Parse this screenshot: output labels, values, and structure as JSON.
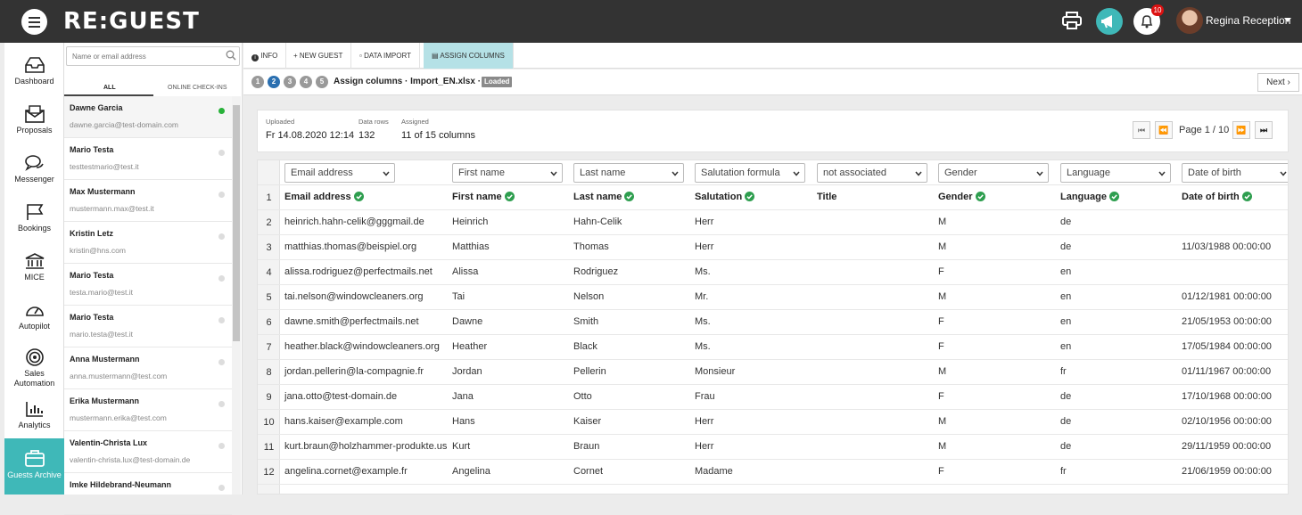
{
  "app": {
    "logo": "RE:GUEST",
    "user_name": "Regina Reception",
    "notification_count": "10"
  },
  "nav": [
    {
      "label": "Dashboard",
      "icon": "dashboard-icon"
    },
    {
      "label": "Proposals",
      "icon": "proposals-icon"
    },
    {
      "label": "Messenger",
      "icon": "messenger-icon"
    },
    {
      "label": "Bookings",
      "icon": "bookings-icon"
    },
    {
      "label": "MICE",
      "icon": "mice-icon"
    },
    {
      "label": "Autopilot",
      "icon": "autopilot-icon"
    },
    {
      "label": "Sales Automation",
      "icon": "sales-automation-icon"
    },
    {
      "label": "Analytics",
      "icon": "analytics-icon"
    },
    {
      "label": "Guests Archive",
      "icon": "guests-archive-icon",
      "active": true
    }
  ],
  "guest_list": {
    "search_placeholder": "Name or email address",
    "tab_all": "ALL",
    "tab_online": "ONLINE CHECK-INS",
    "items": [
      {
        "name": "Dawne Garcia",
        "email": "dawne.garcia@test-domain.com",
        "online": true
      },
      {
        "name": "Mario Testa",
        "email": "testtestmario@test.it"
      },
      {
        "name": "Max Mustermann",
        "email": "mustermann.max@test.it"
      },
      {
        "name": "Kristin Letz",
        "email": "kristin@hns.com"
      },
      {
        "name": "Mario Testa",
        "email": "testa.mario@test.it"
      },
      {
        "name": "Mario Testa",
        "email": "mario.testa@test.it"
      },
      {
        "name": "Anna Mustermann",
        "email": "anna.mustermann@test.com"
      },
      {
        "name": "Erika Mustermann",
        "email": "mustermann.erika@test.com"
      },
      {
        "name": "Valentin-Christa Lux",
        "email": "valentin-christa.lux@test-domain.de"
      },
      {
        "name": "Imke Hildebrand-Neumann",
        "email": ""
      }
    ]
  },
  "tabs": {
    "info": "INFO",
    "new_guest": "+ NEW GUEST",
    "data_import": "DATA IMPORT",
    "assign_columns": "ASSIGN COLUMNS"
  },
  "wizard": {
    "steps": [
      "1",
      "2",
      "3",
      "4",
      "5"
    ],
    "current_step": "2",
    "title": "Assign columns · Import_EN.xlsx ·",
    "status": "Loaded",
    "next": "Next"
  },
  "summary": {
    "uploaded_label": "Uploaded",
    "uploaded_value": "Fr 14.08.2020 12:14",
    "rows_label": "Data rows",
    "rows_value": "132",
    "assigned_label": "Assigned",
    "assigned_value": "11 of 15 columns",
    "page_label": "Page 1 / 10"
  },
  "column_selects": [
    "Email address",
    "First name",
    "Last name",
    "Salutation formula",
    "not associated",
    "Gender",
    "Language",
    "Date of birth"
  ],
  "table": {
    "headers": [
      {
        "label": "Email address",
        "ok": true
      },
      {
        "label": "First name",
        "ok": true
      },
      {
        "label": "Last name",
        "ok": true
      },
      {
        "label": "Salutation",
        "ok": true
      },
      {
        "label": "Title",
        "ok": false
      },
      {
        "label": "Gender",
        "ok": true
      },
      {
        "label": "Language",
        "ok": true
      },
      {
        "label": "Date of birth",
        "ok": true
      }
    ],
    "header_row_number": "1",
    "rows": [
      {
        "n": "2",
        "cells": [
          "heinrich.hahn-celik@gggmail.de",
          "Heinrich",
          "Hahn-Celik",
          "Herr",
          "",
          "M",
          "de",
          ""
        ]
      },
      {
        "n": "3",
        "cells": [
          "matthias.thomas@beispiel.org",
          "Matthias",
          "Thomas",
          "Herr",
          "",
          "M",
          "de",
          "11/03/1988 00:00:00"
        ]
      },
      {
        "n": "4",
        "cells": [
          "alissa.rodriguez@perfectmails.net",
          "Alissa",
          "Rodriguez",
          "Ms.",
          "",
          "F",
          "en",
          ""
        ]
      },
      {
        "n": "5",
        "cells": [
          "tai.nelson@windowcleaners.org",
          "Tai",
          "Nelson",
          "Mr.",
          "",
          "M",
          "en",
          "01/12/1981 00:00:00"
        ]
      },
      {
        "n": "6",
        "cells": [
          "dawne.smith@perfectmails.net",
          "Dawne",
          "Smith",
          "Ms.",
          "",
          "F",
          "en",
          "21/05/1953 00:00:00"
        ]
      },
      {
        "n": "7",
        "cells": [
          "heather.black@windowcleaners.org",
          "Heather",
          "Black",
          "Ms.",
          "",
          "F",
          "en",
          "17/05/1984 00:00:00"
        ]
      },
      {
        "n": "8",
        "cells": [
          "jordan.pellerin@la-compagnie.fr",
          "Jordan",
          "Pellerin",
          "Monsieur",
          "",
          "M",
          "fr",
          "01/11/1967 00:00:00"
        ]
      },
      {
        "n": "9",
        "cells": [
          "jana.otto@test-domain.de",
          "Jana",
          "Otto",
          "Frau",
          "",
          "F",
          "de",
          "17/10/1968 00:00:00"
        ]
      },
      {
        "n": "10",
        "cells": [
          "hans.kaiser@example.com",
          "Hans",
          "Kaiser",
          "Herr",
          "",
          "M",
          "de",
          "02/10/1956 00:00:00"
        ]
      },
      {
        "n": "11",
        "cells": [
          "kurt.braun@holzhammer-produkte.us",
          "Kurt",
          "Braun",
          "Herr",
          "",
          "M",
          "de",
          "29/11/1959 00:00:00"
        ]
      },
      {
        "n": "12",
        "cells": [
          "angelina.cornet@example.fr",
          "Angelina",
          "Cornet",
          "Madame",
          "",
          "F",
          "fr",
          "21/06/1959 00:00:00"
        ]
      }
    ]
  },
  "colors": {
    "accent": "#3fb8b8",
    "ok_green": "#2e9e4f",
    "topbar": "#333333",
    "selected_tab": "#b5e1e6"
  }
}
